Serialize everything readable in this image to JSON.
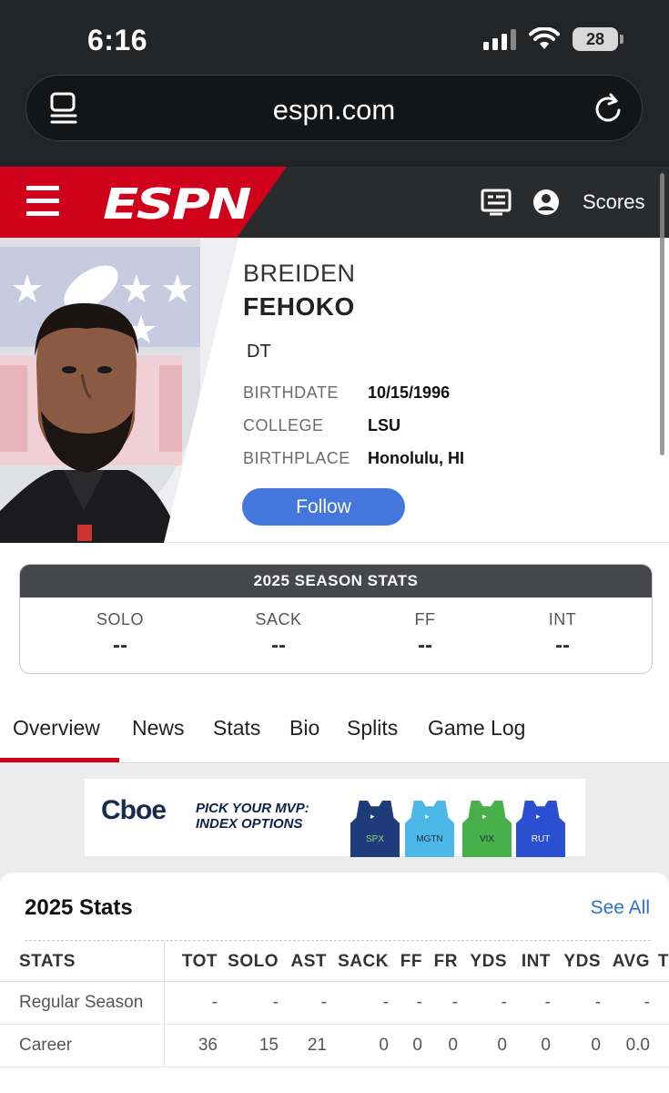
{
  "status_bar": {
    "time": "6:16",
    "battery": "28"
  },
  "browser": {
    "url": "espn.com"
  },
  "espn_header": {
    "logo": "ESPN",
    "scores_label": "Scores"
  },
  "player": {
    "first_name": "BREIDEN",
    "last_name": "FEHOKO",
    "position": "DT",
    "info": [
      {
        "label": "BIRTHDATE",
        "value": "10/15/1996"
      },
      {
        "label": "COLLEGE",
        "value": "LSU"
      },
      {
        "label": "BIRTHPLACE",
        "value": "Honolulu, HI"
      }
    ],
    "follow_label": "Follow"
  },
  "season_stats": {
    "title": "2025 SEASON STATS",
    "columns": [
      {
        "label": "SOLO",
        "value": "--"
      },
      {
        "label": "SACK",
        "value": "--"
      },
      {
        "label": "FF",
        "value": "--"
      },
      {
        "label": "INT",
        "value": "--"
      }
    ]
  },
  "tabs": [
    "Overview",
    "News",
    "Stats",
    "Bio",
    "Splits",
    "Game Log"
  ],
  "active_tab": "Overview",
  "ad": {
    "brand": "Cboe",
    "headline_line1": "PICK YOUR MVP:",
    "headline_line2": "INDEX OPTIONS",
    "jerseys": [
      {
        "label": "SPX",
        "color": "#1f3c7a"
      },
      {
        "label": "MGTN",
        "color": "#4cb8e8"
      },
      {
        "label": "VIX",
        "color": "#48b04a"
      },
      {
        "label": "RUT",
        "color": "#2b4fd1"
      }
    ]
  },
  "stats_table": {
    "title": "2025 Stats",
    "see_all": "See All",
    "headers": [
      "STATS",
      "TOT",
      "SOLO",
      "AST",
      "SACK",
      "FF",
      "FR",
      "YDS",
      "INT",
      "YDS",
      "AVG",
      "T"
    ],
    "rows": [
      [
        "Regular Season",
        "-",
        "-",
        "-",
        "-",
        "-",
        "-",
        "-",
        "-",
        "-",
        "-"
      ],
      [
        "Career",
        "36",
        "15",
        "21",
        "0",
        "0",
        "0",
        "0",
        "0",
        "0",
        "0.0"
      ]
    ]
  },
  "colors": {
    "espn_red": "#d0021b",
    "follow_blue": "#4477dd",
    "link_blue": "#2f6fcf"
  }
}
